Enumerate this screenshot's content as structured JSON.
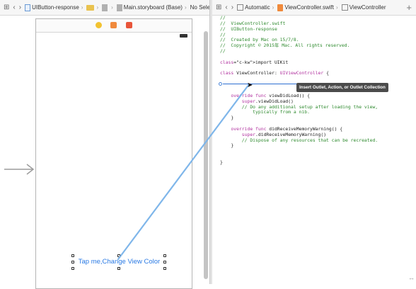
{
  "left_toolbar": {
    "project": "UIButton-response",
    "file": "Main.storyboard (Base)",
    "selection": "No Selection"
  },
  "right_toolbar": {
    "mode": "Automatic",
    "file": "ViewController.swift",
    "symbol": "ViewController"
  },
  "scene": {
    "button_title": "Tap me,Change View Color"
  },
  "tooltip": "Insert Outlet, Action, or Outlet Collection",
  "code": {
    "lines": [
      {
        "text": "//",
        "kind": "com"
      },
      {
        "text": "//  ViewController.swift",
        "kind": "com"
      },
      {
        "text": "//  UIButton-response",
        "kind": "com"
      },
      {
        "text": "//",
        "kind": "com"
      },
      {
        "text": "//  Created by Mac on 15/7/8.",
        "kind": "com"
      },
      {
        "text": "//  Copyright © 2015年 Mac. All rights reserved.",
        "kind": "com"
      },
      {
        "text": "//",
        "kind": "com"
      },
      {
        "text": "",
        "kind": "plain"
      },
      {
        "text": "import UIKit",
        "kind": "plain"
      },
      {
        "text": "",
        "kind": "plain"
      },
      {
        "text": "class ViewController: UIViewController {",
        "kind": "plain"
      },
      {
        "text": "",
        "kind": "plain"
      },
      {
        "text": "",
        "kind": "plain"
      },
      {
        "text": "",
        "kind": "plain"
      },
      {
        "text": "    override func viewDidLoad() {",
        "kind": "plain"
      },
      {
        "text": "        super.viewDidLoad()",
        "kind": "plain"
      },
      {
        "text": "        // Do any additional setup after loading the view,",
        "kind": "com"
      },
      {
        "text": "            typically from a nib.",
        "kind": "com"
      },
      {
        "text": "    }",
        "kind": "plain"
      },
      {
        "text": "",
        "kind": "plain"
      },
      {
        "text": "    override func didReceiveMemoryWarning() {",
        "kind": "plain"
      },
      {
        "text": "        super.didReceiveMemoryWarning()",
        "kind": "plain"
      },
      {
        "text": "        // Dispose of any resources that can be recreated.",
        "kind": "com"
      },
      {
        "text": "    }",
        "kind": "plain"
      },
      {
        "text": "",
        "kind": "plain"
      },
      {
        "text": "",
        "kind": "plain"
      },
      {
        "text": "}",
        "kind": "plain"
      }
    ]
  }
}
